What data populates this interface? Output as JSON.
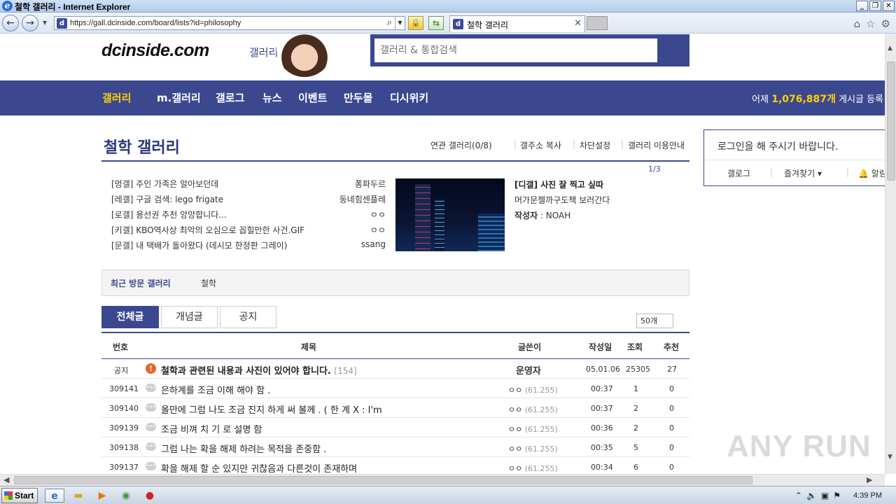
{
  "window": {
    "title": "철학 갤러리 - Internet Explorer"
  },
  "browser": {
    "url": "https://gall.dcinside.com/board/lists?id=philosophy",
    "tab_title": "철학 갤러리"
  },
  "header": {
    "logo": "dcinside.com",
    "logo_sub": "갤러리",
    "search_placeholder": "갤러리 & 통합검색"
  },
  "gnb": {
    "items": [
      "갤러리",
      "m.갤러리",
      "갤로그",
      "뉴스",
      "이벤트",
      "만두몰",
      "디시위키"
    ],
    "count_prefix": "어제",
    "count_value": "1,076,887개",
    "count_suffix": "게시글 등록"
  },
  "gallery": {
    "title": "철학 갤러리",
    "links": [
      "연관 갤러리(0/8)",
      "갤주소 복사",
      "차단설정",
      "갤러리 이용안내"
    ],
    "page_indicator": "1/3"
  },
  "hot_posts": [
    {
      "title": "[멍갤] 주인 가족은 알아보던데",
      "writer": "퐁파두르"
    },
    {
      "title": "[레갤] 구글 검색: lego frigate",
      "writer": "동네힘센플레"
    },
    {
      "title": "[로갤] 용선권 추천 앙망합니다...",
      "writer": "ㅇㅇ"
    },
    {
      "title": "[키갤] KBO역사상 최악의 오심으로 꼽힐만한 사건.GIF",
      "writer": "ㅇㅇ"
    },
    {
      "title": "[문갤] 내 택배가 돌아왔다 (데시모 한정판 그레이)",
      "writer": "ssang"
    }
  ],
  "featured": {
    "title": "[디갤] 사진 잘 찍고 싶따",
    "desc": "머가문젤까구도책 보러간다",
    "author_label": "작성자",
    "author": ": NOAH"
  },
  "recent": {
    "label": "최근 방문 갤러리",
    "item": "철학"
  },
  "tabs": [
    "전체글",
    "개념글",
    "공지"
  ],
  "list_size": "50개",
  "board": {
    "columns": [
      "번호",
      "제목",
      "글쓴이",
      "작성일",
      "조회",
      "추천"
    ],
    "notice": {
      "no": "공지",
      "subject": "철학과 관련된 내용과 사진이 있어야 합니다.",
      "replies": "[154]",
      "writer": "운영자",
      "date": "05.01.06",
      "views": "25305",
      "recommend": "27"
    },
    "rows": [
      {
        "no": "309141",
        "subject": "은하계를 조금 이해 해야 함 .",
        "writer": "ㅇㅇ",
        "ip": "(61.255)",
        "date": "00:37",
        "views": "1",
        "recommend": "0"
      },
      {
        "no": "309140",
        "subject": "올만에 그럼 나도 조금 진지 하게 써 볼께 . ( 한 계 X : I'm",
        "writer": "ㅇㅇ",
        "ip": "(61.255)",
        "date": "00:37",
        "views": "2",
        "recommend": "0"
      },
      {
        "no": "309139",
        "subject": "조금 비껴 치 기 로 설명 함",
        "writer": "ㅇㅇ",
        "ip": "(61.255)",
        "date": "00:36",
        "views": "2",
        "recommend": "0"
      },
      {
        "no": "309138",
        "subject": "그럼 나는 확을 해제 하려는 목적을 존중함 .",
        "writer": "ㅇㅇ",
        "ip": "(61.255)",
        "date": "00:35",
        "views": "5",
        "recommend": "0"
      },
      {
        "no": "309137",
        "subject": "확을 해제 할 순 있지만 귀찮음과 다른것이 존재하며",
        "writer": "ㅇㅇ",
        "ip": "(61.255)",
        "date": "00:34",
        "views": "6",
        "recommend": "0"
      }
    ]
  },
  "login": {
    "message": "로그인을 해 주시기 바랍니다.",
    "links": [
      "갤로그",
      "즐겨찾기 ▾",
      "알림"
    ]
  },
  "watermark": "ANY RUN",
  "taskbar": {
    "start": "Start",
    "clock": "4:39 PM"
  }
}
